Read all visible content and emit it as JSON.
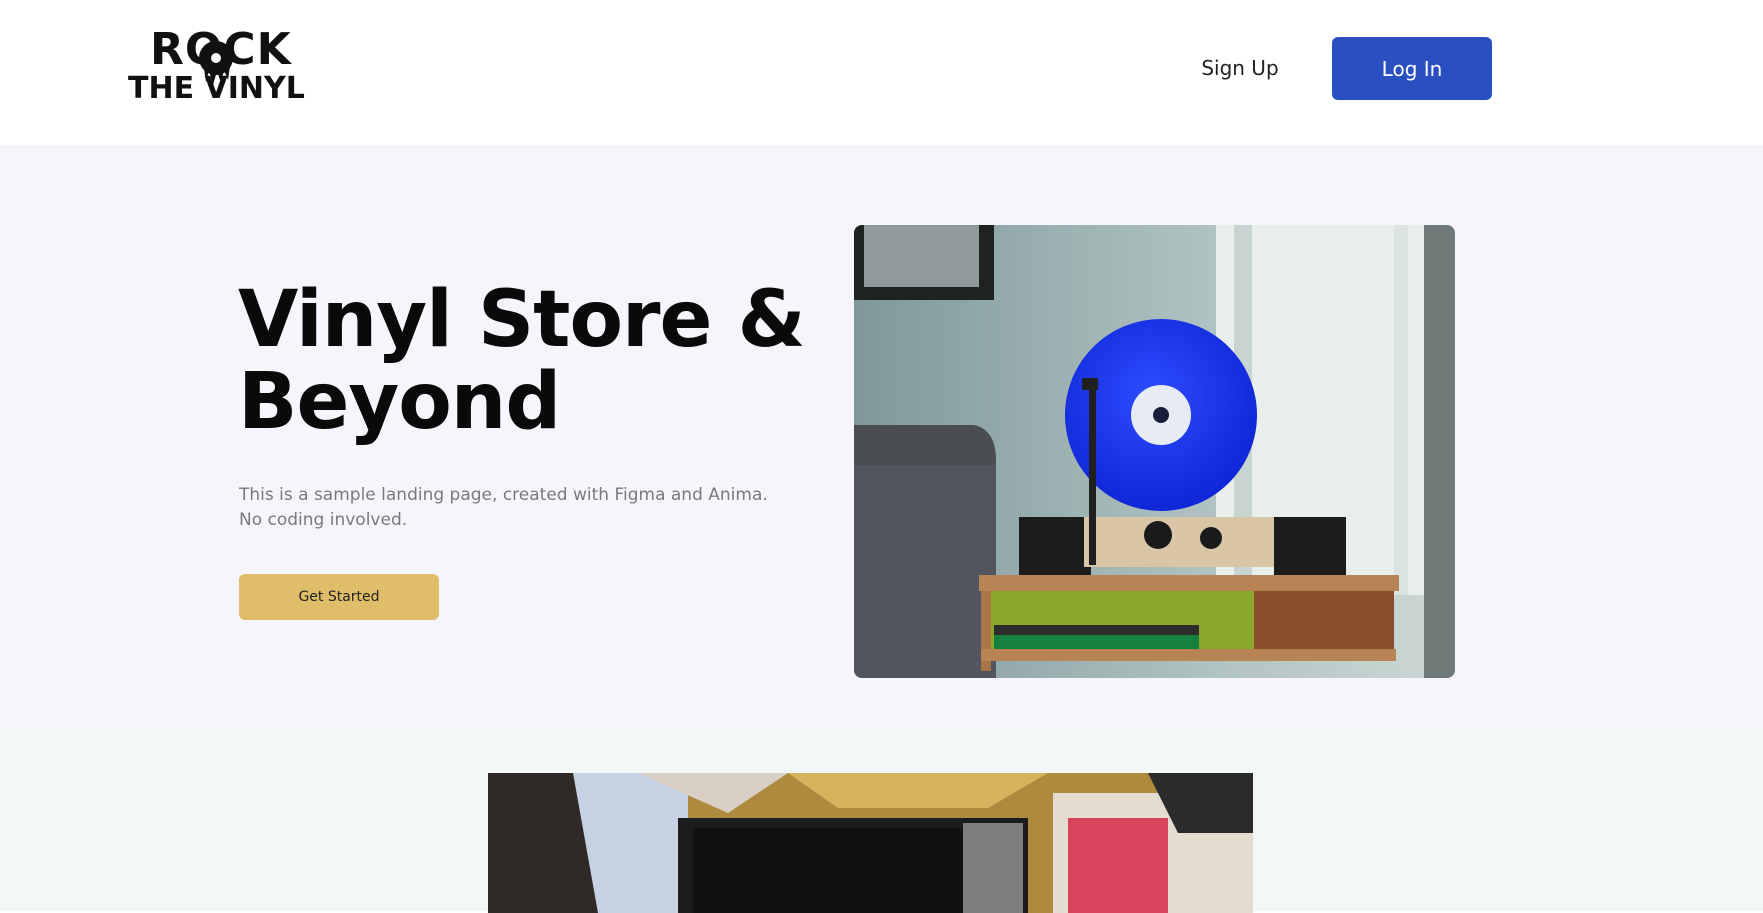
{
  "header": {
    "logo_line1": "ROCK",
    "logo_line2": "THE VINYL",
    "signup_label": "Sign Up",
    "login_label": "Log In"
  },
  "hero": {
    "title": "Vinyl Store & Beyond",
    "description": "This is a sample landing page, created with Figma and Anima. No coding involved.",
    "cta_label": "Get Started"
  },
  "colors": {
    "primary": "#2a4fc1",
    "accent": "#e0bd69",
    "hero_bg": "#f6f5fc",
    "section2_bg": "#f1f8f5"
  }
}
